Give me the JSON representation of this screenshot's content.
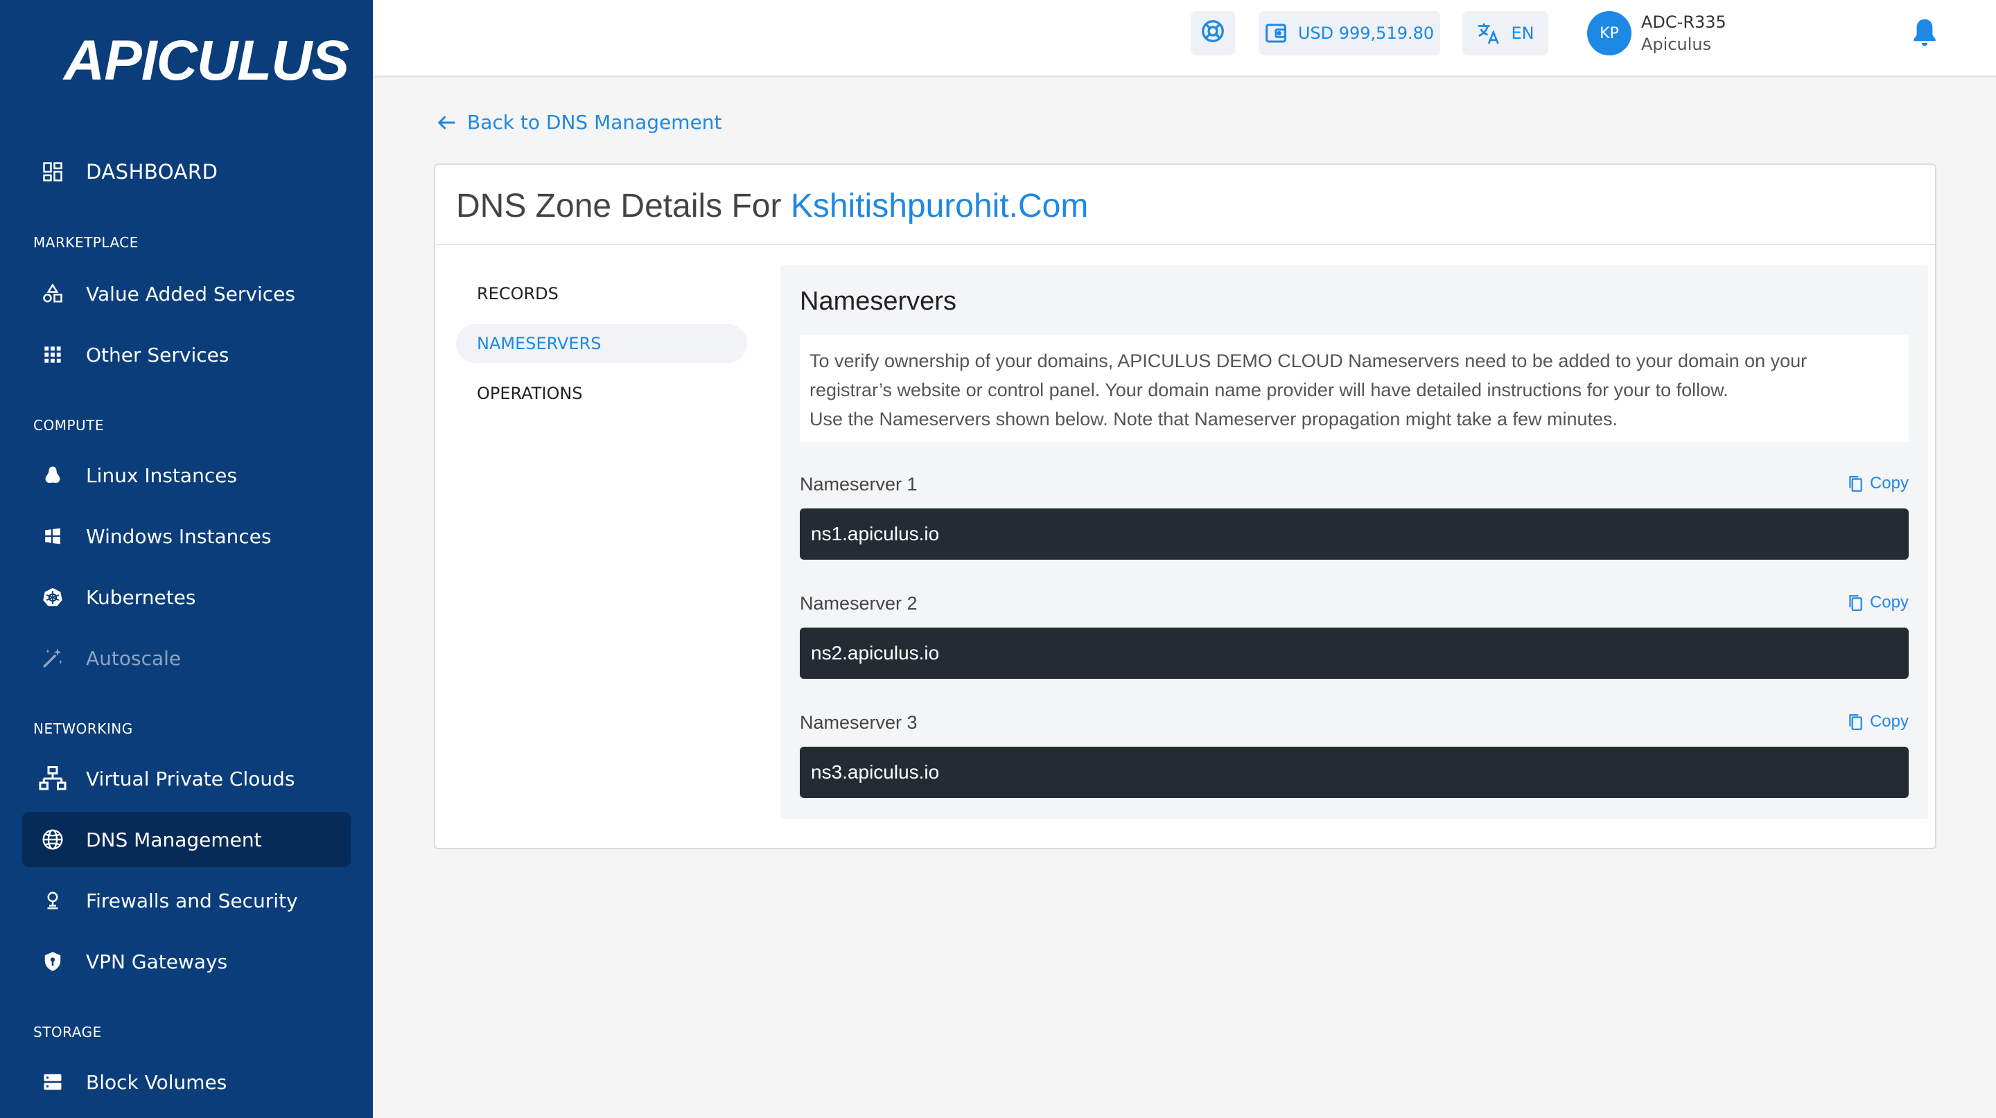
{
  "brand": {
    "logo_text": "APICULUS"
  },
  "sidebar": {
    "dashboard": "DASHBOARD",
    "sections": {
      "marketplace": "MARKETPLACE",
      "compute": "COMPUTE",
      "networking": "NETWORKING",
      "storage": "STORAGE"
    },
    "items": {
      "value_added_services": "Value Added Services",
      "other_services": "Other Services",
      "linux_instances": "Linux Instances",
      "windows_instances": "Windows Instances",
      "kubernetes": "Kubernetes",
      "autoscale": "Autoscale",
      "virtual_private_clouds": "Virtual Private Clouds",
      "dns_management": "DNS Management",
      "firewalls_and_security": "Firewalls and Security",
      "vpn_gateways": "VPN Gateways",
      "block_volumes": "Block Volumes"
    },
    "active": "dns_management"
  },
  "header": {
    "balance": "USD 999,519.80",
    "language": "EN",
    "avatar_initials": "KP",
    "account_id": "ADC-R335",
    "account_org": "Apiculus"
  },
  "main": {
    "back_link": "Back to DNS Management",
    "title_prefix": "DNS Zone Details For",
    "title_domain": "Kshitishpurohit.Com",
    "tabs": [
      "RECORDS",
      "NAMESERVERS",
      "OPERATIONS"
    ],
    "active_tab": "NAMESERVERS",
    "panel": {
      "title": "Nameservers",
      "info_line1": "To verify ownership of your domains, APICULUS DEMO CLOUD Nameservers need to be added to your domain on your",
      "info_line2": "registrar’s website or control panel. Your domain name provider will have detailed instructions for your to follow.",
      "info_line3": "Use the Nameservers shown below. Note that Nameserver propagation might take a few minutes.",
      "copy_label": "Copy",
      "nameservers": [
        {
          "label": "Nameserver 1",
          "value": "ns1.apiculus.io"
        },
        {
          "label": "Nameserver 2",
          "value": "ns2.apiculus.io"
        },
        {
          "label": "Nameserver 3",
          "value": "ns3.apiculus.io"
        }
      ]
    }
  },
  "colors": {
    "sidebar_bg": "#0a3d7a",
    "sidebar_active": "#062b59",
    "accent": "#1e88e5",
    "code_bg": "#252b33"
  }
}
